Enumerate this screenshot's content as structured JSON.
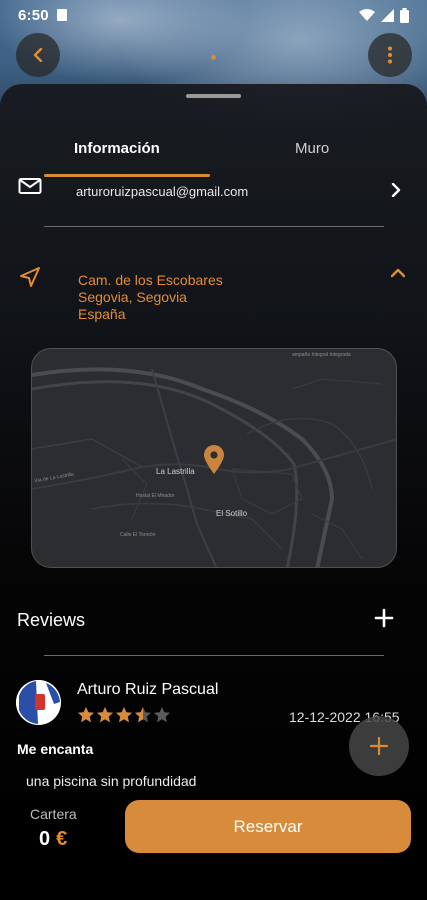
{
  "status_bar": {
    "time": "6:50"
  },
  "tabs": [
    {
      "label": "Información",
      "active": true
    },
    {
      "label": "Muro",
      "active": false
    }
  ],
  "contact": {
    "email": "arturoruizpascual@gmail.com"
  },
  "location": {
    "line1": "Cam. de los Escobares",
    "line2": "Segovia, Segovia",
    "line3": "España"
  },
  "map": {
    "labels": {
      "town": "La Lastrilla",
      "district": "El Sotillo",
      "road": "Vía de La Lastrilla",
      "hostel": "Hostal El Mirador",
      "street": "Calle El Torreón",
      "corner": "ampaña Integral Integrada"
    }
  },
  "reviews": {
    "title": "Reviews",
    "items": [
      {
        "author": "Arturo Ruiz Pascual",
        "rating": 3.5,
        "max_rating": 5,
        "date": "12-12-2022",
        "time": "16:55",
        "title": "Me encanta",
        "body": "una piscina sin profundidad"
      }
    ]
  },
  "wallet": {
    "label": "Cartera",
    "amount": "0",
    "currency": "€"
  },
  "reserve_button": {
    "label": "Reservar"
  },
  "colors": {
    "accent": "#d88b3b",
    "accent_text": "#e38d33",
    "star_empty": "#5a5a5a"
  },
  "icons": [
    "back-arrow-icon",
    "more-vertical-icon",
    "mail-icon",
    "chevron-right-icon",
    "location-arrow-icon",
    "chevron-up-icon",
    "map-pin-icon",
    "plus-icon",
    "star-icon"
  ]
}
